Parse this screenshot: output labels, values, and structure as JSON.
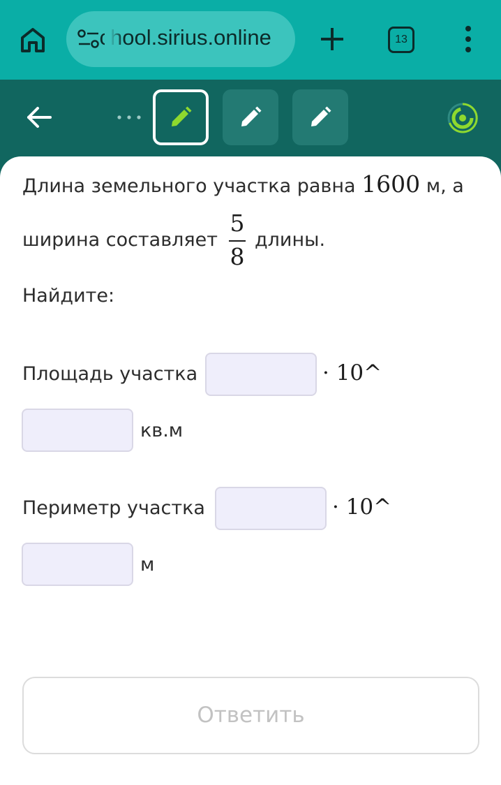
{
  "browser": {
    "url": "school.sirius.online",
    "tab_count": "13",
    "toolbar_color": "#0aaea6"
  },
  "header": {
    "more": "···",
    "steps": [
      {
        "state": "active",
        "icon": "pencil-icon"
      },
      {
        "state": "default",
        "icon": "pencil-icon"
      },
      {
        "state": "default",
        "icon": "pencil-icon"
      }
    ],
    "accent_color": "#8fd92e"
  },
  "problem": {
    "line1_text": "Длина земельного участка равна",
    "line1_value": "1600",
    "line1_unit": "м, а",
    "line2_text": "ширина составляет",
    "fraction_num": "5",
    "fraction_den": "8",
    "line2_tail": "длины.",
    "prompt": "Найдите:"
  },
  "area": {
    "label": "Площадь участка",
    "mantissa_value": "",
    "pow_text": "· 10^",
    "exponent_value": "",
    "unit": "кв.м"
  },
  "perimeter": {
    "label": "Периметр участка",
    "mantissa_value": "",
    "pow_text": "· 10^",
    "exponent_value": "",
    "unit": "м"
  },
  "submit": {
    "label": "Ответить"
  }
}
